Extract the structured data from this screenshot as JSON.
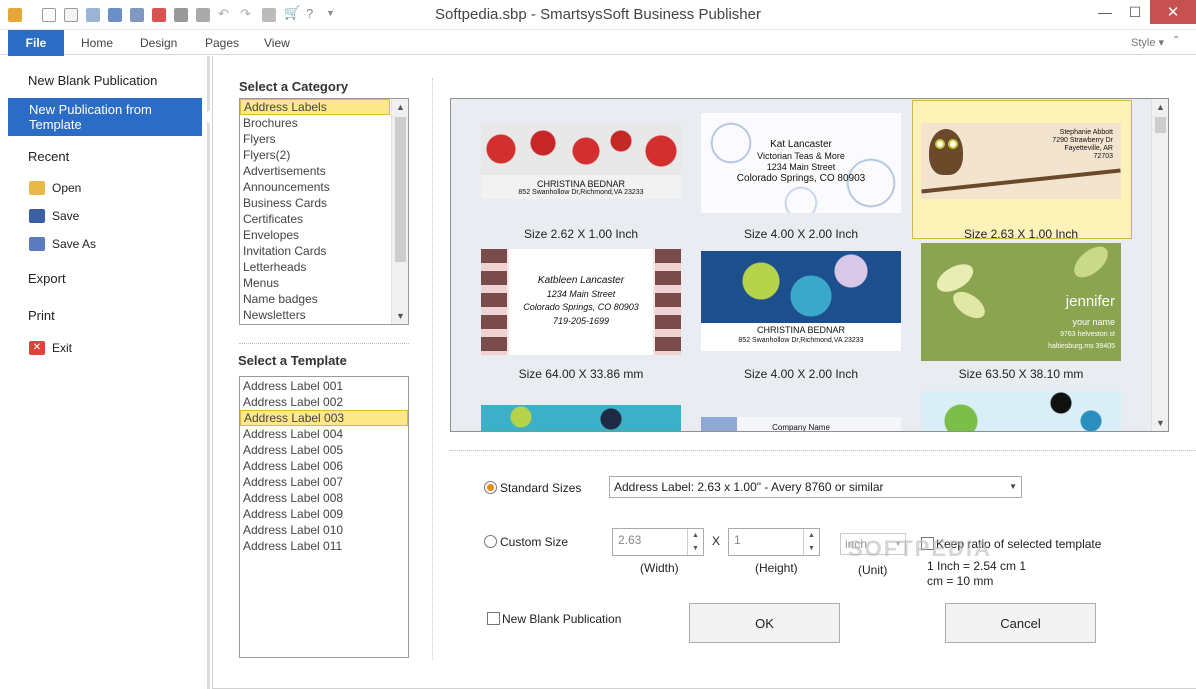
{
  "window": {
    "title": "Softpedia.sbp - SmartsysSoft Business Publisher",
    "minimize": "—",
    "maximize": "☐",
    "close": "✕"
  },
  "ribbon": {
    "tabs": [
      "File",
      "Home",
      "Design",
      "Pages",
      "View"
    ],
    "style_label": "Style"
  },
  "left_nav": {
    "new_blank": "New Blank Publication",
    "new_from_template": "New Publication from Template",
    "recent": "Recent",
    "open": "Open",
    "save": "Save",
    "save_as": "Save As",
    "export": "Export",
    "print": "Print",
    "exit": "Exit"
  },
  "category": {
    "heading": "Select a Category",
    "items": [
      "Address Labels",
      "Brochures",
      "Flyers",
      "Flyers(2)",
      "Advertisements",
      "Announcements",
      "Business Cards",
      "Certificates",
      "Envelopes",
      "Invitation Cards",
      "Letterheads",
      "Menus",
      "Name badges",
      "Newsletters"
    ],
    "selected": "Address Labels"
  },
  "template": {
    "heading": "Select a Template",
    "items": [
      "Address Label 001",
      "Address Label 002",
      "Address Label 003",
      "Address Label 004",
      "Address Label 005",
      "Address Label 006",
      "Address Label 007",
      "Address Label 008",
      "Address Label 009",
      "Address Label 010",
      "Address Label 011"
    ],
    "selected": "Address Label 003"
  },
  "gallery": {
    "cards": [
      {
        "size": "Size 2.62 X 1.00 Inch",
        "lines": [
          "CHRISTINA BEDNAR",
          "852 Swanhollow Dr,Richmond,VA 23233"
        ]
      },
      {
        "size": "Size 4.00 X 2.00 Inch",
        "lines": [
          "Kat Lancaster",
          "Victorian Teas & More",
          "1234 Main Street",
          "Colorado Springs, CO 80903"
        ]
      },
      {
        "size": "Size 2.63 X 1.00 Inch",
        "lines": [
          "Stephanie Abbott",
          "7290 Strawberry Dr",
          "Fayetteville, AR",
          "72703"
        ]
      },
      {
        "size": "Size 64.00 X 33.86 mm",
        "lines": [
          "Katbleen Lancaster",
          "1234 Main Street",
          "Colorado Springs, CO 80903",
          "719-205-1699"
        ]
      },
      {
        "size": "Size 4.00 X 2.00 Inch",
        "lines": [
          "CHRISTINA BEDNAR",
          "852 Swanhollow Dr,Richmond,VA 23233"
        ]
      },
      {
        "size": "Size 63.50 X 38.10 mm",
        "lines": [
          "jennifer",
          "your name",
          "9763 helveston st",
          "haltiesburg.ms 39405"
        ]
      },
      {
        "size": "",
        "lines": []
      },
      {
        "size": "",
        "lines": [
          "Company Name"
        ]
      },
      {
        "size": "",
        "lines": []
      }
    ],
    "selected_index": 2
  },
  "options": {
    "standard_sizes_label": "Standard Sizes",
    "standard_sizes_value": "Address Label: 2.63 x 1.00\" - Avery 8760 or similar",
    "custom_size_label": "Custom Size",
    "width_value": "2.63",
    "height_value": "1",
    "x_sep": "X",
    "unit_value": "inch",
    "width_caption": "(Width)",
    "height_caption": "(Height)",
    "unit_caption": "(Unit)",
    "keep_ratio_label": "Keep ratio of selected template",
    "conversion_line1": "1 Inch = 2.54 cm  1",
    "conversion_line2": "cm = 10 mm",
    "new_blank_label": "New Blank Publication",
    "ok_label": "OK",
    "cancel_label": "Cancel",
    "standard_selected": true
  },
  "watermark": "SOFTPEDIA",
  "colors": {
    "accent": "#2b6cc7",
    "selection": "#fde88a",
    "close": "#c75050"
  }
}
